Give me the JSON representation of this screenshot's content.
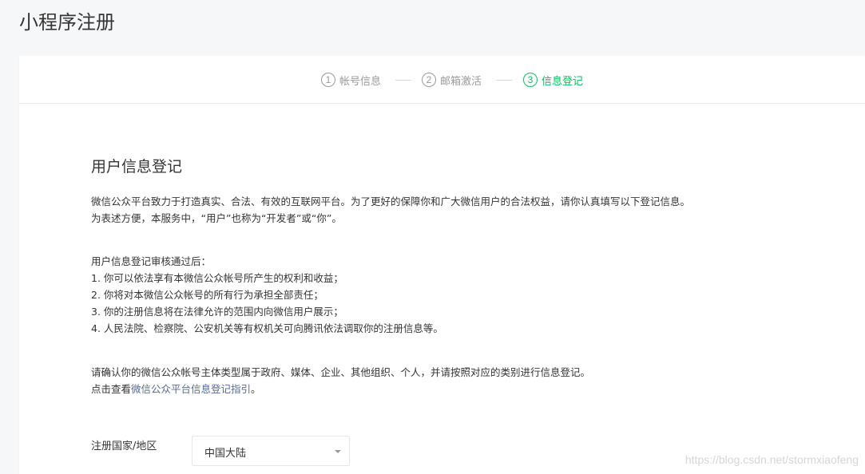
{
  "page": {
    "title": "小程序注册"
  },
  "steps": [
    {
      "num": "1",
      "label": "帐号信息",
      "active": false
    },
    {
      "num": "2",
      "label": "邮箱激活",
      "active": false
    },
    {
      "num": "3",
      "label": "信息登记",
      "active": true
    }
  ],
  "section": {
    "title": "用户信息登记",
    "intro": [
      "微信公众平台致力于打造真实、合法、有效的互联网平台。为了更好的保障你和广大微信用户的合法权益，请你认真填写以下登记信息。",
      "为表述方便，本服务中，“用户”也称为“开发者”或“你”。"
    ],
    "review": [
      "用户信息登记审核通过后：",
      "1. 你可以依法享有本微信公众帐号所产生的权利和收益；",
      "2. 你将对本微信公众帐号的所有行为承担全部责任；",
      "3. 你的注册信息将在法律允许的范围内向微信用户展示；",
      "4. 人民法院、检察院、公安机关等有权机关可向腾讯依法调取你的注册信息等。"
    ],
    "confirm": "请确认你的微信公众帐号主体类型属于政府、媒体、企业、其他组织、个人，并请按照对应的类别进行信息登记。",
    "guide_prefix": "点击查看",
    "guide_link": "微信公众平台信息登记指引",
    "guide_suffix": "。"
  },
  "form": {
    "country_label": "注册国家/地区",
    "country_value": "中国大陆"
  },
  "watermark": "https://blog.csdn.net/stormxiaofeng",
  "colors": {
    "accent": "#07c160",
    "link": "#576b95",
    "muted": "#9a9a9a"
  }
}
